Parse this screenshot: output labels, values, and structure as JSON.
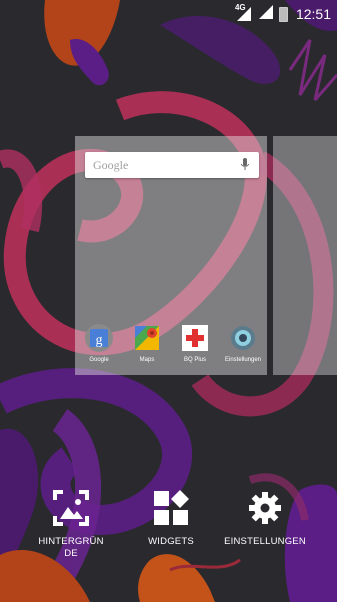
{
  "status_bar": {
    "network_type": "4G",
    "time": "12:51"
  },
  "home_preview": {
    "search": {
      "logo_text": "Google"
    },
    "apps": [
      {
        "label": "Google",
        "icon": "google-search-icon"
      },
      {
        "label": "Maps",
        "icon": "maps-icon"
      },
      {
        "label": "BQ Plus",
        "icon": "bq-plus-icon"
      },
      {
        "label": "Einstellungen",
        "icon": "settings-icon"
      }
    ]
  },
  "overview_options": {
    "wallpaper_label_line1": "HINTERGRÜN",
    "wallpaper_label_line2": "DE",
    "widgets_label": "WIDGETS",
    "settings_label": "EINSTELLUNGEN"
  },
  "colors": {
    "background": "#2a2a2e",
    "wallpaper_pink": "#c0305a",
    "wallpaper_purple": "#5b1e86",
    "wallpaper_orange": "#c4531a"
  }
}
